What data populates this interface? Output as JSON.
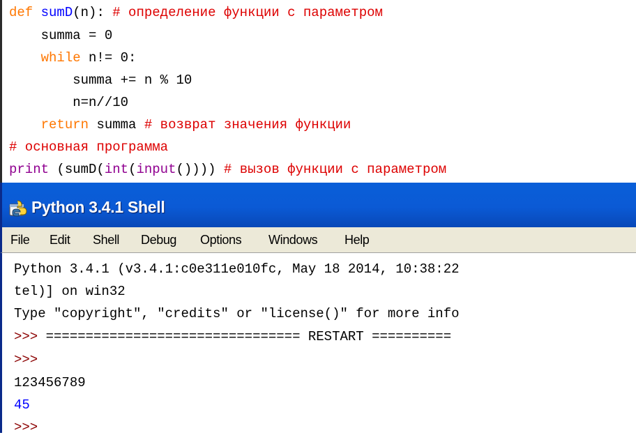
{
  "editor": {
    "line1": {
      "kw": "def",
      "name": "sumD",
      "rest": "(n):",
      "comment": "# определение функции с параметром"
    },
    "line2": {
      "text": "summa = 0"
    },
    "line3": {
      "kw": "while",
      "rest": "n!= 0:"
    },
    "line4": {
      "text": "summa += n % 10"
    },
    "line5": {
      "text": "n=n//10"
    },
    "line6": {
      "kw": "return",
      "rest": "summa",
      "comment": "# возврат значения функции"
    },
    "line7": {
      "comment": "# основная программа"
    },
    "line8": {
      "bi_print": "print",
      "p1": "(sumD(",
      "bi_int": "int",
      "p2": "(",
      "bi_input": "input",
      "p3": "())))",
      "comment": "# вызов функции с параметром"
    }
  },
  "shell": {
    "title": "Python 3.4.1 Shell",
    "menu": [
      "File",
      "Edit",
      "Shell",
      "Debug",
      "Options",
      "Windows",
      "Help"
    ],
    "output": {
      "banner1": "Python 3.4.1 (v3.4.1:c0e311e010fc, May 18 2014, 10:38:22",
      "banner2": "tel)] on win32",
      "banner3": "Type \"copyright\", \"credits\" or \"license()\" for more info",
      "restart_prompt": ">>>",
      "restart_text": " ================================ RESTART ==========",
      "prompt2": ">>>",
      "user_input": "123456789",
      "result": "45",
      "prompt3": ">>>"
    }
  },
  "colors": {
    "keyword": "#ff7700",
    "defname": "#0000ff",
    "comment": "#dd0000",
    "builtin": "#900090",
    "prompt": "#8b0000",
    "result": "#0000ff",
    "titlebar": "#0b5ad5"
  },
  "icons": {
    "window": "python-idle-icon"
  }
}
